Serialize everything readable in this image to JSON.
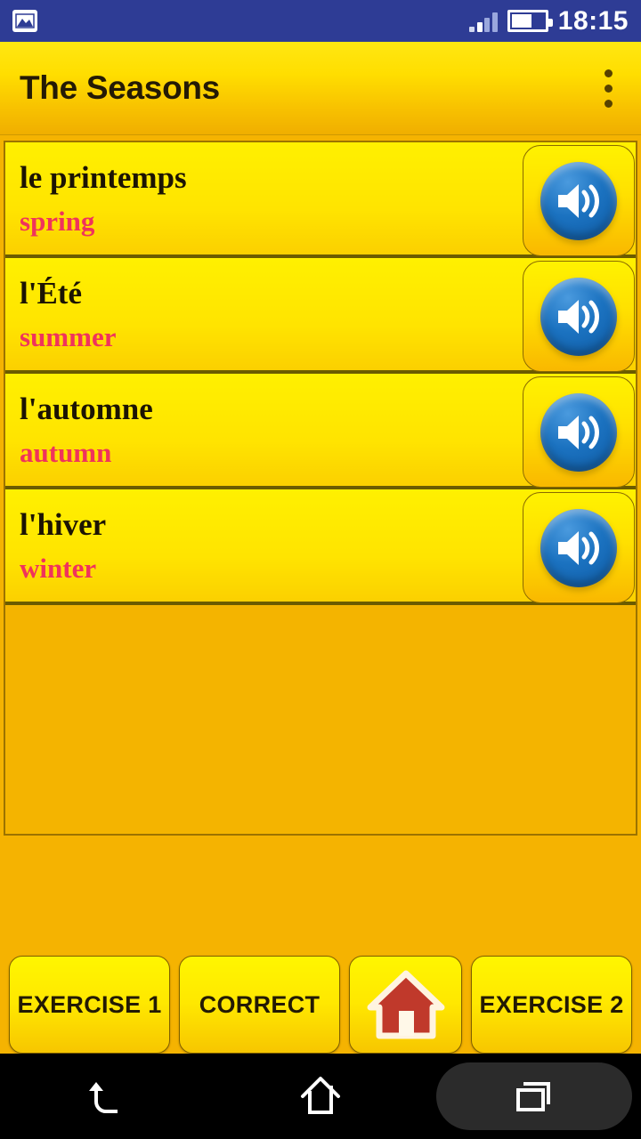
{
  "status_bar": {
    "notification_icon": "gallery-image-icon",
    "signal_icon": "signal-bars-icon",
    "battery_icon": "battery-icon",
    "battery_level_percent": 62,
    "time": "18:15"
  },
  "app_bar": {
    "title": "The Seasons",
    "overflow_icon": "overflow-menu-icon"
  },
  "list": {
    "rows": [
      {
        "term": "le printemps",
        "translation": "spring",
        "speak_icon": "speaker-icon"
      },
      {
        "term": "l'Été",
        "translation": "summer",
        "speak_icon": "speaker-icon"
      },
      {
        "term": "l'automne",
        "translation": "autumn",
        "speak_icon": "speaker-icon"
      },
      {
        "term": "l'hiver",
        "translation": "winter",
        "speak_icon": "speaker-icon"
      }
    ]
  },
  "bottom_bar": {
    "buttons": [
      {
        "label": "EXERCISE 1"
      },
      {
        "label": "CORRECT"
      },
      {
        "label": "",
        "icon": "home-house-icon"
      },
      {
        "label": "EXERCISE 2"
      }
    ]
  },
  "nav_bar": {
    "back_icon": "back-arrow-icon",
    "home_icon": "home-outline-icon",
    "recents_icon": "recents-squares-icon"
  },
  "colors": {
    "status_bar_bg": "#2E3C95",
    "app_bar_top": "#FFE712",
    "app_bar_bottom": "#F0AE00",
    "row_bg": "#FFE400",
    "page_bg": "#F5B301",
    "term_text": "#1C1403",
    "translation_text": "#F0335C",
    "speaker_blue": "#1B72C0",
    "home_red": "#C0392B",
    "divider": "#6B5B00"
  }
}
